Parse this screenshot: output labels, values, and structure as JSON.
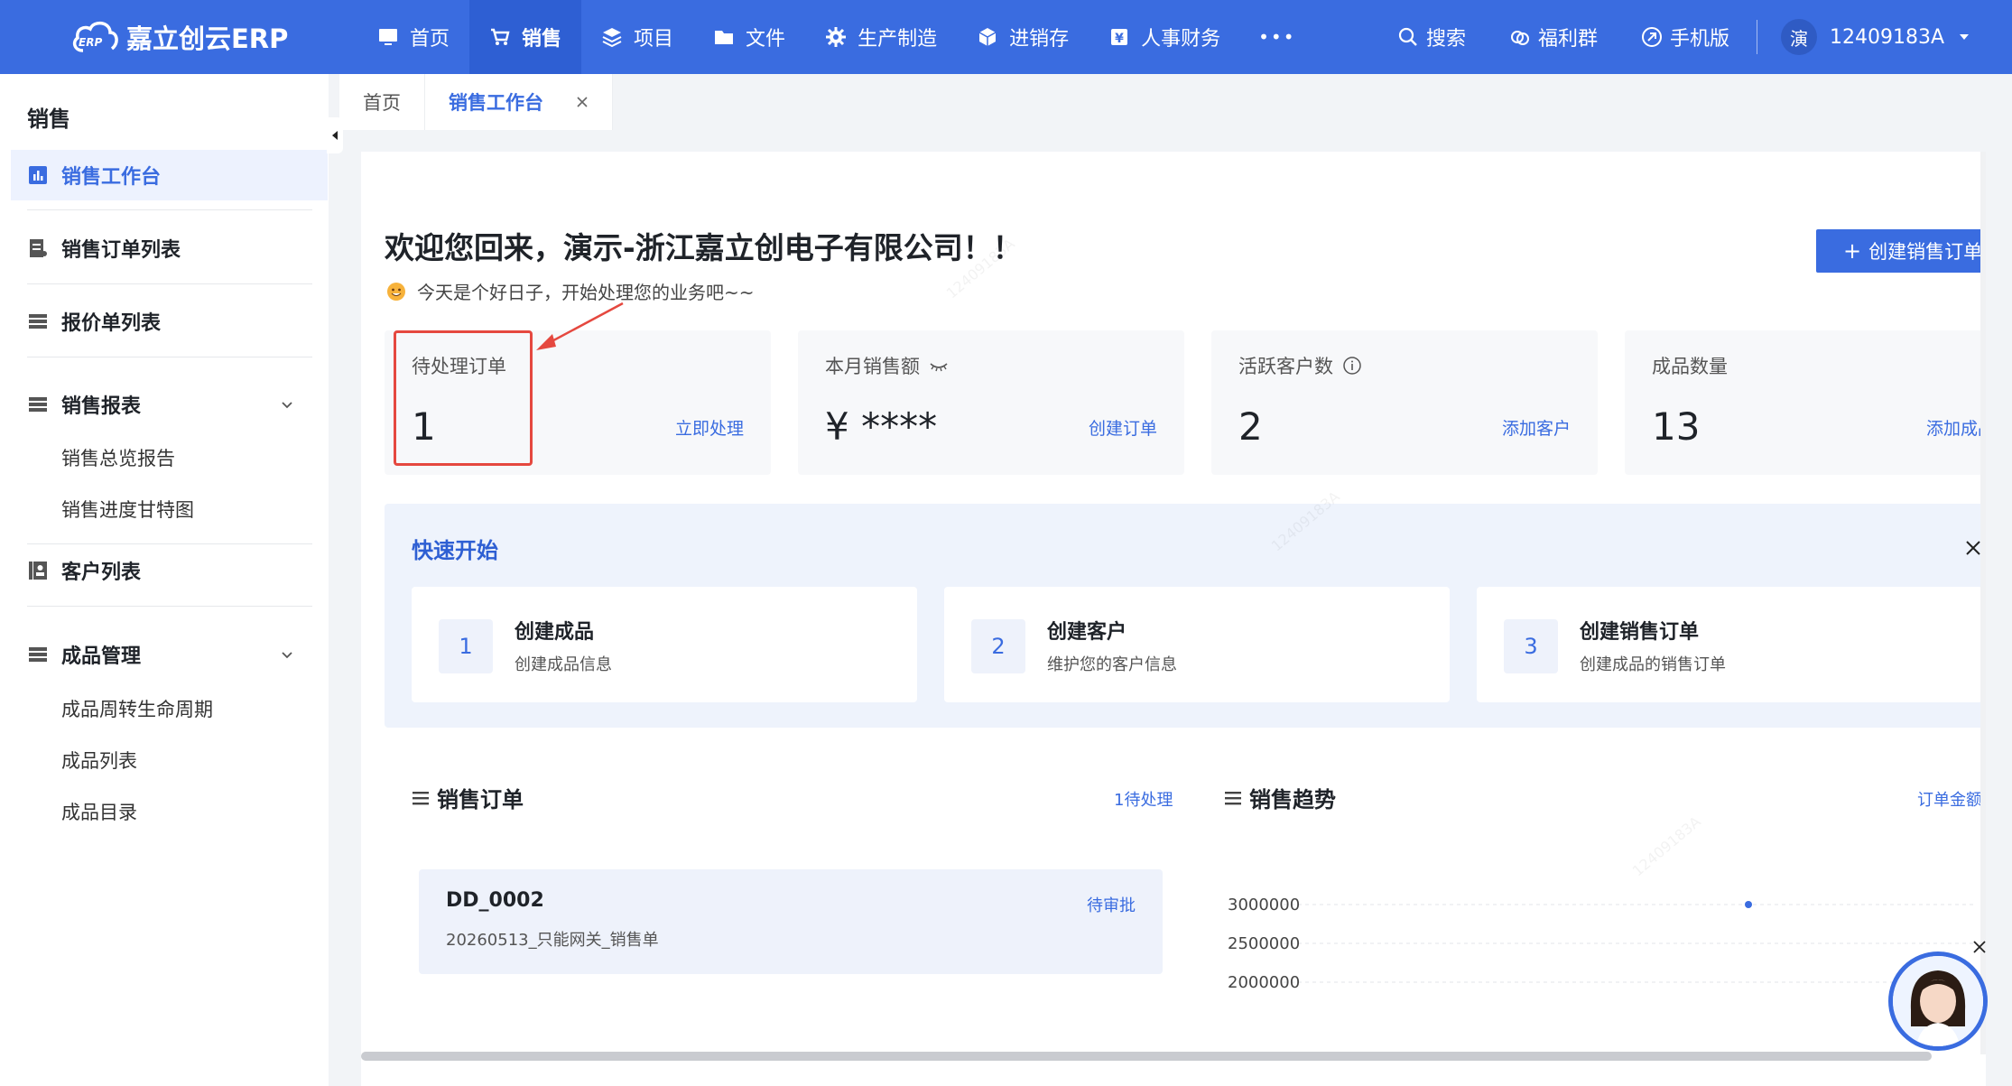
{
  "topbar": {
    "logo_text": "嘉立创云ERP",
    "logo_badge": "ERP",
    "nav": [
      {
        "label": "首页",
        "icon": "monitor-icon"
      },
      {
        "label": "销售",
        "icon": "cart-icon",
        "active": true
      },
      {
        "label": "项目",
        "icon": "layers-icon"
      },
      {
        "label": "文件",
        "icon": "folder-icon"
      },
      {
        "label": "生产制造",
        "icon": "gear-icon"
      },
      {
        "label": "进销存",
        "icon": "box-icon"
      },
      {
        "label": "人事财务",
        "icon": "finance-icon"
      }
    ],
    "more_label": "•••",
    "tools": [
      {
        "label": "搜索",
        "icon": "search-icon"
      },
      {
        "label": "福利群",
        "icon": "group-icon"
      },
      {
        "label": "手机版",
        "icon": "mobile-icon"
      }
    ],
    "user": {
      "avatar_text": "演",
      "name": "12409183A"
    }
  },
  "sidebar": {
    "title": "销售",
    "items": [
      {
        "label": "销售工作台",
        "icon": "chart-bar-icon",
        "active": true
      },
      {
        "label": "销售订单列表",
        "icon": "document-list-icon"
      },
      {
        "label": "报价单列表",
        "icon": "list-icon"
      },
      {
        "label": "销售报表",
        "icon": "list-icon",
        "expanded": true
      },
      {
        "label": "客户列表",
        "icon": "contacts-icon"
      },
      {
        "label": "成品管理",
        "icon": "list-icon",
        "expanded": true
      }
    ],
    "sub_report": [
      "销售总览报告",
      "销售进度甘特图"
    ],
    "sub_product": [
      "成品周转生命周期",
      "成品列表",
      "成品目录"
    ]
  },
  "tabs": [
    {
      "label": "首页"
    },
    {
      "label": "销售工作台",
      "active": true
    }
  ],
  "main": {
    "welcome": "欢迎您回来，演示-浙江嘉立创电子有限公司！！",
    "subline": "今天是个好日子，开始处理您的业务吧~~",
    "create_button": "创建销售订单",
    "stats": [
      {
        "label": "待处理订单",
        "value": "1",
        "action": "立即处理"
      },
      {
        "label": "本月销售额",
        "value": "¥ ****",
        "action": "创建订单",
        "icon": "eye-closed-icon"
      },
      {
        "label": "活跃客户数",
        "value": "2",
        "action": "添加客户",
        "icon": "info-icon"
      },
      {
        "label": "成品数量",
        "value": "13",
        "action": "添加成品"
      }
    ],
    "quick": {
      "title": "快速开始",
      "cards": [
        {
          "num": "1",
          "title": "创建成品",
          "desc": "创建成品信息"
        },
        {
          "num": "2",
          "title": "创建客户",
          "desc": "维护您的客户信息"
        },
        {
          "num": "3",
          "title": "创建销售订单",
          "desc": "创建成品的销售订单"
        }
      ]
    },
    "orders": {
      "title": "销售订单",
      "link": "1待处理",
      "items": [
        {
          "id": "DD_0002",
          "desc": "20260513_只能网关_销售单",
          "status": "待审批"
        }
      ]
    },
    "trend": {
      "title": "销售趋势",
      "link": "订单金额"
    }
  },
  "chart_data": {
    "type": "scatter",
    "ylabel": "",
    "y_ticks": [
      "3000000",
      "2500000",
      "2000000"
    ],
    "points": [
      {
        "y": 3000000
      }
    ]
  },
  "colors": {
    "brand": "#3a6ce0",
    "highlight": "#e5483f"
  }
}
